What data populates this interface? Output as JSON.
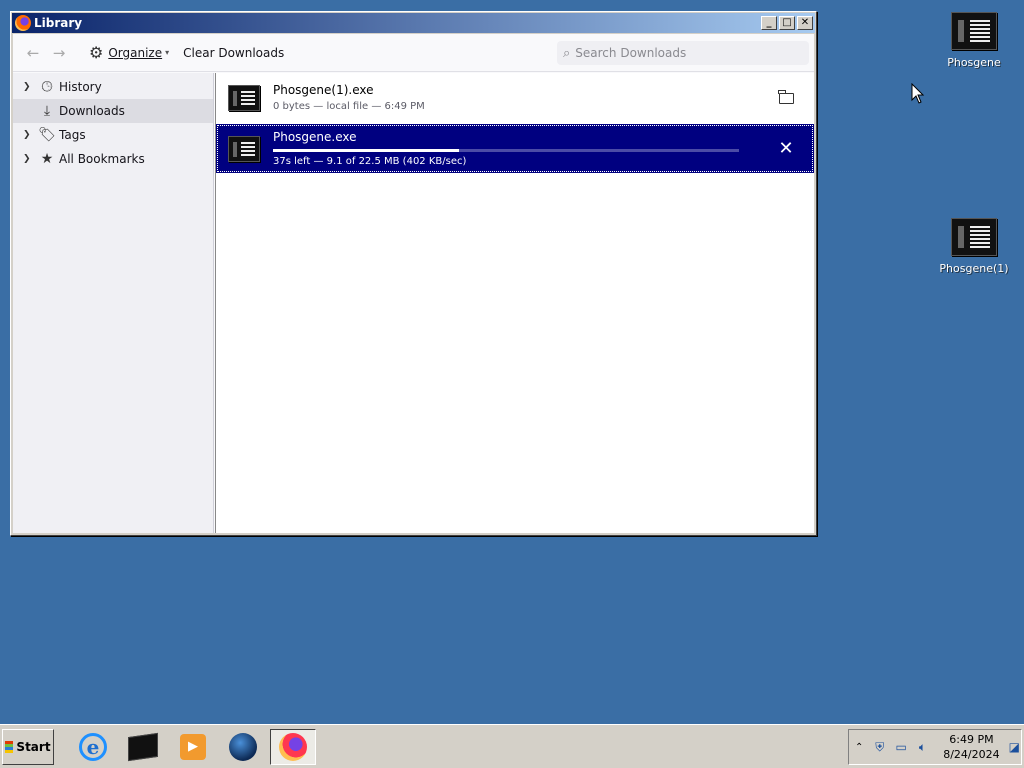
{
  "desktop": {
    "icons": [
      {
        "label": "Phosgene"
      },
      {
        "label": "Phosgene(1)"
      }
    ]
  },
  "window": {
    "title": "Library",
    "controls": {
      "minimize": "_",
      "maximize": "□",
      "close": "✕"
    }
  },
  "toolbar": {
    "back_icon": "←",
    "forward_icon": "→",
    "organize_label": "Organize",
    "clear_label": "Clear Downloads",
    "search_placeholder": "Search Downloads"
  },
  "sidebar": {
    "items": [
      {
        "label": "History",
        "icon": "clock-icon",
        "expandable": true
      },
      {
        "label": "Downloads",
        "icon": "download-icon",
        "expandable": false,
        "selected": true
      },
      {
        "label": "Tags",
        "icon": "tag-icon",
        "expandable": true
      },
      {
        "label": "All Bookmarks",
        "icon": "star-icon",
        "expandable": true
      }
    ]
  },
  "downloads": [
    {
      "name": "Phosgene(1).exe",
      "status": "0 bytes — local file — 6:49 PM",
      "action_icon": "folder-icon",
      "selected": false
    },
    {
      "name": "Phosgene.exe",
      "status": "37s left — 9.1 of 22.5 MB (402 KB/sec)",
      "action_icon": "cancel-icon",
      "selected": true,
      "progress": 0.4
    }
  ],
  "taskbar": {
    "start_label": "Start",
    "apps": [
      "internet-explorer-icon",
      "terminal-icon",
      "media-player-icon",
      "globe-icon",
      "firefox-icon"
    ],
    "clock_time": "6:49 PM",
    "clock_date": "8/24/2024"
  },
  "colors": {
    "desktop": "#3a6ea5",
    "selected_row": "#000080",
    "titlebar_start": "#0a246a"
  }
}
